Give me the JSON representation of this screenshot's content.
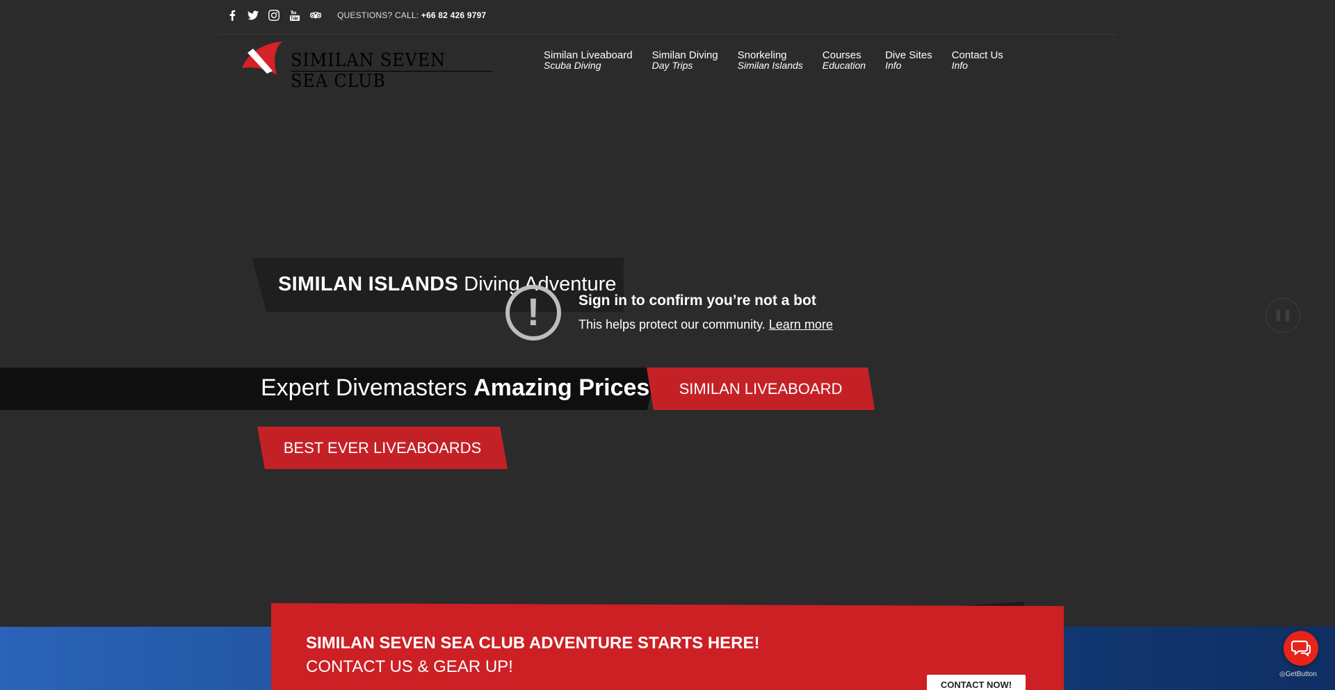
{
  "topbar": {
    "social_icons": [
      "facebook-icon",
      "twitter-icon",
      "instagram-icon",
      "youtube-icon",
      "tripadvisor-icon"
    ],
    "questions_label": "QUESTIONS? CALL:",
    "phone": "+66 82 426 9797"
  },
  "logo": {
    "text": "SIMILAN SEVEN SEA CLUB"
  },
  "nav": {
    "items": [
      {
        "title": "Similan Liveaboard",
        "subtitle": "Scuba Diving"
      },
      {
        "title": "Similan Diving",
        "subtitle": "Day Trips"
      },
      {
        "title": "Snorkeling",
        "subtitle": "Similan Islands"
      },
      {
        "title": "Courses",
        "subtitle": "Education"
      },
      {
        "title": "Dive Sites",
        "subtitle": "Info"
      },
      {
        "title": "Contact Us",
        "subtitle": "Info"
      }
    ]
  },
  "hero": {
    "title_bold": "SIMILAN ISLANDS",
    "title_rest": " Diving Adventure",
    "tagline_plain": "Expert Divemasters ",
    "tagline_bold": "Amazing Prices",
    "btn_liveaboard": "SIMILAN LIVEABOARD",
    "btn_best": "BEST EVER LIVEABOARDS"
  },
  "overlay": {
    "title": "Sign in to confirm you’re not a bot",
    "subtitle": "This helps protect our community. ",
    "link": "Learn more",
    "pause_icon": "pause-icon"
  },
  "cta": {
    "title": "SIMILAN SEVEN SEA CLUB ADVENTURE STARTS HERE!",
    "subtitle": "CONTACT US & GEAR UP! ",
    "button": "CONTACT NOW!"
  },
  "widget": {
    "brand": "GetButton"
  },
  "colors": {
    "accent_red": "#c42127",
    "dark_bg": "#2b2b2c",
    "blue": "#1f4f96"
  }
}
